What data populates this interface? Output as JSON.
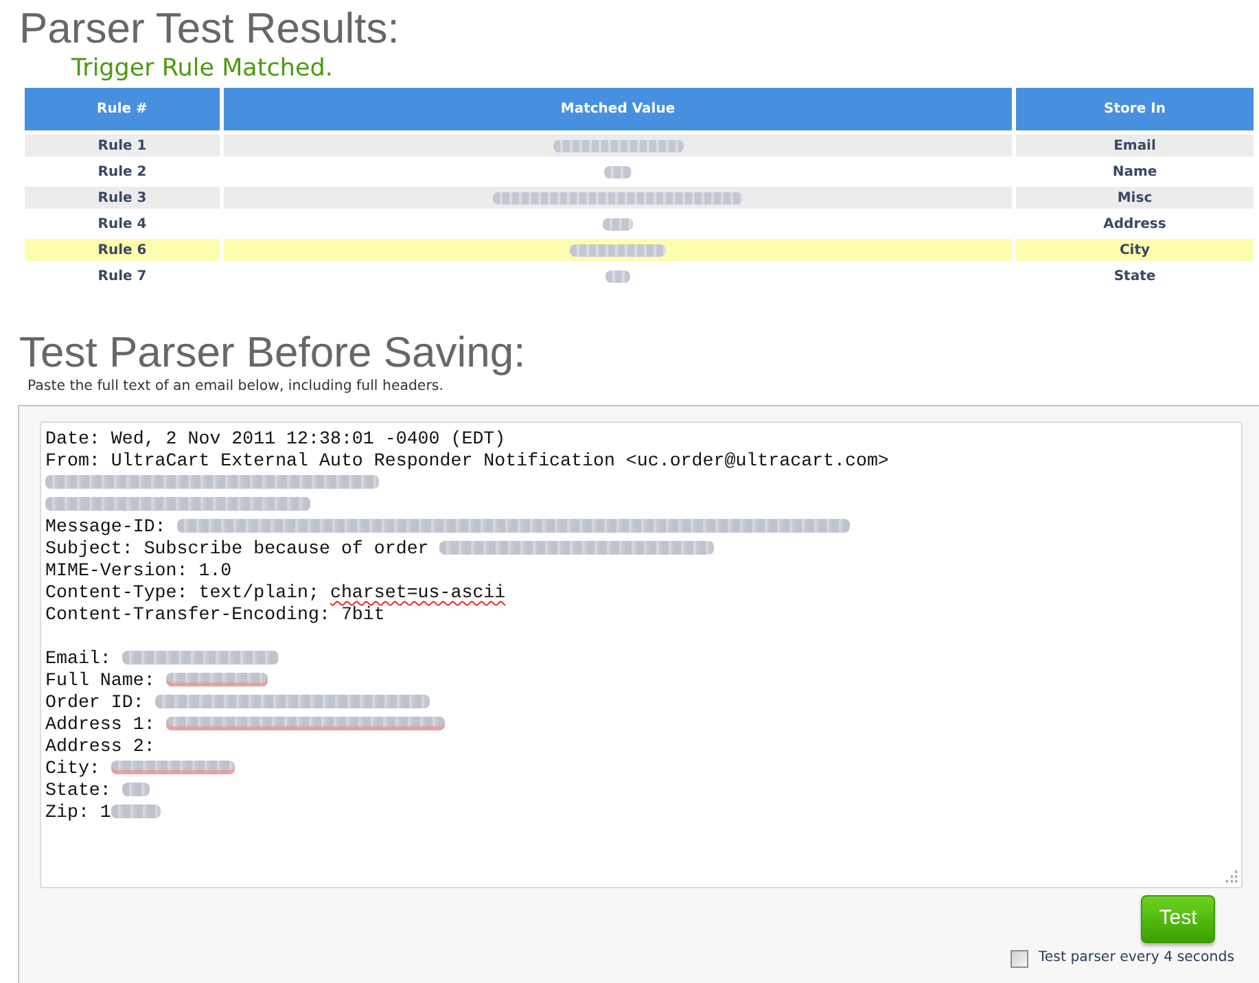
{
  "results": {
    "title": "Parser Test Results:",
    "status": "Trigger Rule Matched.",
    "table": {
      "columns": [
        "Rule #",
        "Matched Value",
        "Store In"
      ],
      "rows": [
        {
          "rule": "Rule 1",
          "matched_value": {
            "kind": "blurred"
          },
          "store_in": "Email",
          "highlighted": false
        },
        {
          "rule": "Rule 2",
          "matched_value": {
            "kind": "blurred"
          },
          "store_in": "Name",
          "highlighted": false
        },
        {
          "rule": "Rule 3",
          "matched_value": {
            "kind": "blurred"
          },
          "store_in": "Misc",
          "highlighted": false
        },
        {
          "rule": "Rule 4",
          "matched_value": {
            "kind": "blurred"
          },
          "store_in": "Address",
          "highlighted": false
        },
        {
          "rule": "Rule 6",
          "matched_value": {
            "kind": "blurred"
          },
          "store_in": "City",
          "highlighted": true
        },
        {
          "rule": "Rule 7",
          "matched_value": {
            "kind": "blurred"
          },
          "store_in": "State",
          "highlighted": false
        }
      ]
    }
  },
  "test_parser": {
    "title": "Test Parser Before Saving:",
    "instructions": "Paste the full text of an email below, including full headers.",
    "email": {
      "headers": [
        [
          {
            "kind": "text",
            "text": "Date: Wed, 2 Nov 2011 12:38:01 -0400 (EDT)",
            "misspelled": false
          }
        ],
        [
          {
            "kind": "text",
            "text": "From: UltraCart External Auto Responder Notification <uc.order@ultracart.com>",
            "misspelled": false
          }
        ],
        [
          {
            "kind": "blurred",
            "misspelled": false
          }
        ],
        [
          {
            "kind": "blurred",
            "misspelled": false
          }
        ],
        [
          {
            "kind": "text",
            "text": "Message-ID: ",
            "misspelled": false
          },
          {
            "kind": "blurred",
            "misspelled": false
          }
        ],
        [
          {
            "kind": "text",
            "text": "Subject: Subscribe because of order ",
            "misspelled": false
          },
          {
            "kind": "blurred",
            "misspelled": false
          }
        ],
        [
          {
            "kind": "text",
            "text": "MIME-Version: 1.0",
            "misspelled": false
          }
        ],
        [
          {
            "kind": "text",
            "text": "Content-Type: text/plain; ",
            "misspelled": false
          },
          {
            "kind": "text",
            "text": "charset=us-ascii",
            "misspelled": true
          }
        ],
        [
          {
            "kind": "text",
            "text": "Content-Transfer-Encoding: 7bit",
            "misspelled": false
          }
        ]
      ],
      "body": [
        [
          {
            "kind": "text",
            "text": "Email: ",
            "misspelled": false
          },
          {
            "kind": "blurred",
            "misspelled": false
          }
        ],
        [
          {
            "kind": "text",
            "text": "Full Name: ",
            "misspelled": false
          },
          {
            "kind": "blurred",
            "misspelled": true
          }
        ],
        [
          {
            "kind": "text",
            "text": "Order ID: ",
            "misspelled": false
          },
          {
            "kind": "blurred",
            "misspelled": false
          }
        ],
        [
          {
            "kind": "text",
            "text": "Address 1: ",
            "misspelled": false
          },
          {
            "kind": "blurred",
            "misspelled": true
          }
        ],
        [
          {
            "kind": "text",
            "text": "Address 2:",
            "misspelled": false
          }
        ],
        [
          {
            "kind": "text",
            "text": "City: ",
            "misspelled": false
          },
          {
            "kind": "blurred",
            "misspelled": true
          }
        ],
        [
          {
            "kind": "text",
            "text": "State: ",
            "misspelled": false
          },
          {
            "kind": "blurred",
            "misspelled": false
          }
        ],
        [
          {
            "kind": "text",
            "text": "Zip: 1",
            "misspelled": false
          },
          {
            "kind": "blurred",
            "misspelled": false
          }
        ]
      ]
    },
    "test_button": "Test",
    "auto_test": {
      "label": "Test parser every 4 seconds",
      "checked": false
    }
  }
}
